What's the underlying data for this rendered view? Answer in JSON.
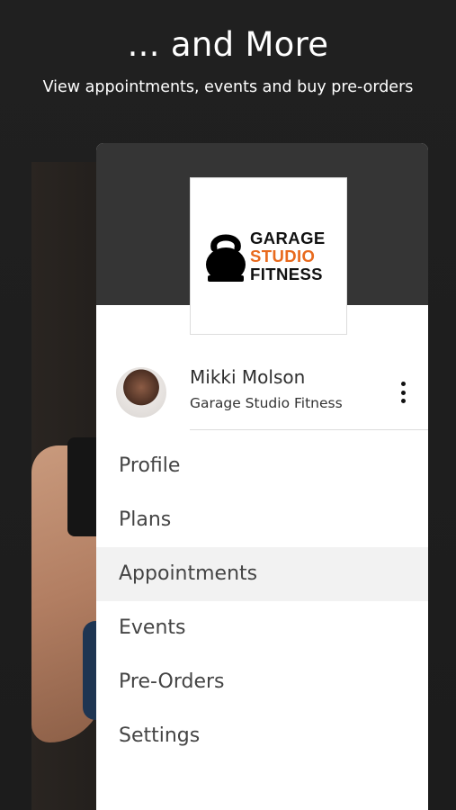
{
  "promo": {
    "title": "... and More",
    "subtitle": "View appointments, events and buy pre-orders"
  },
  "logo": {
    "line1": "GARAGE",
    "line2": "STUDIO",
    "line3": "FITNESS",
    "accent_color": "#e86a1e"
  },
  "user": {
    "name": "Mikki Molson",
    "gym": "Garage Studio Fitness"
  },
  "menu": {
    "items": [
      {
        "label": "Profile"
      },
      {
        "label": "Plans"
      },
      {
        "label": "Appointments",
        "active": true
      },
      {
        "label": "Events"
      },
      {
        "label": "Pre-Orders"
      },
      {
        "label": "Settings"
      }
    ]
  },
  "colors": {
    "background": "#1e1e1e",
    "drawer_header": "#353535",
    "active_item_bg": "#f2f2f2"
  }
}
